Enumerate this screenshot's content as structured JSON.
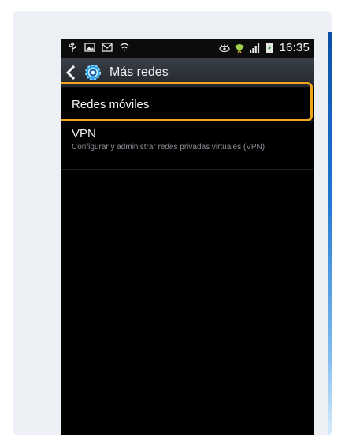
{
  "status_bar": {
    "time": "16:35",
    "left_icons": [
      "usb-icon",
      "image-icon",
      "mail-icon",
      "sync-icon"
    ],
    "right_icons": [
      "eye-icon",
      "wifi-icon",
      "signal-icon",
      "battery-icon"
    ]
  },
  "action_bar": {
    "title": "Más redes",
    "icons": [
      "back-arrow-icon",
      "settings-gear-icon"
    ]
  },
  "list": {
    "mobile_networks": {
      "label": "Redes móviles",
      "highlighted": true
    },
    "vpn": {
      "title": "VPN",
      "description": "Configurar y administrar redes privadas virtuales (VPN)"
    }
  },
  "colors": {
    "highlight": "#f2a31c",
    "screen_bg": "#000000",
    "action_bar": "#2b3036",
    "card_bg": "#eceff4",
    "accent_blue": "#1d75d1"
  }
}
